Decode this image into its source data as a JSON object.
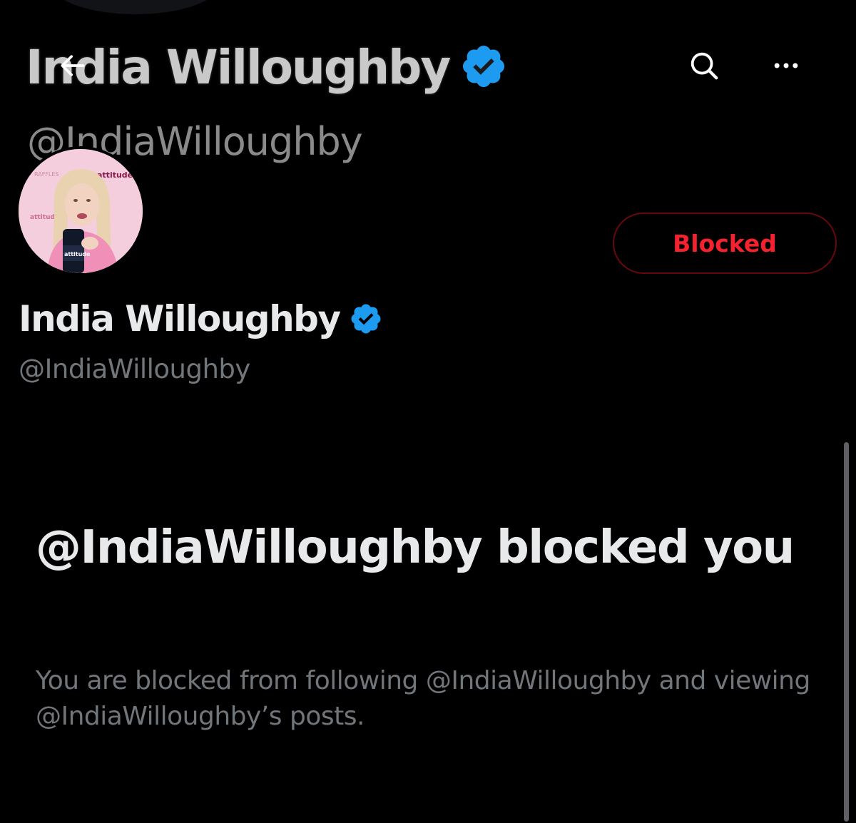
{
  "banner": {
    "title": "India Willoughby",
    "handle": "@IndiaWilloughby"
  },
  "top_bar": {
    "back_icon": "arrow-left-icon",
    "search_icon": "search-icon",
    "more_icon": "more-horizontal-icon"
  },
  "profile": {
    "name": "India Willoughby",
    "handle": "@IndiaWilloughby",
    "verified": true,
    "avatar_logo_text": "attitude",
    "relationship_button_label": "Blocked"
  },
  "blocked_notice": {
    "heading": "@IndiaWilloughby blocked you",
    "body": "You are blocked from following @IndiaWilloughby and viewing @IndiaWilloughby’s posts."
  },
  "colors": {
    "background": "#000000",
    "primary_text": "#e7e9ea",
    "secondary_text": "#71767b",
    "verified_blue": "#1d9bf0",
    "blocked_red": "#f4212e"
  }
}
